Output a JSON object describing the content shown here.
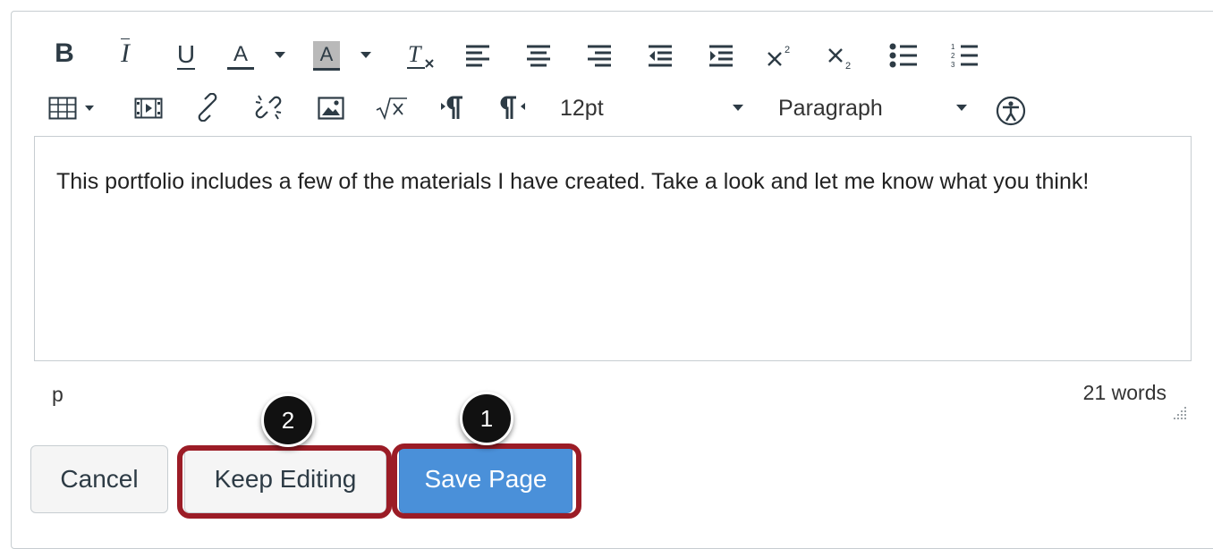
{
  "toolbar": {
    "row1": [
      {
        "icon": "bold-icon",
        "glyph": "B"
      },
      {
        "icon": "italic-icon",
        "glyph": "I"
      },
      {
        "icon": "underline-icon",
        "glyph": "U"
      },
      {
        "icon": "text-color-icon",
        "glyph": "A"
      },
      {
        "icon": "background-color-icon",
        "glyph": "A"
      },
      {
        "icon": "clear-formatting-icon",
        "glyph": "T"
      },
      {
        "icon": "align-left-icon"
      },
      {
        "icon": "align-center-icon"
      },
      {
        "icon": "align-right-icon"
      },
      {
        "icon": "outdent-icon"
      },
      {
        "icon": "indent-icon"
      },
      {
        "icon": "superscript-icon",
        "glyph": "x"
      },
      {
        "icon": "subscript-icon",
        "glyph": "x"
      },
      {
        "icon": "bullet-list-icon"
      },
      {
        "icon": "numbered-list-icon"
      }
    ],
    "font_size": "12pt",
    "block_format": "Paragraph"
  },
  "editor": {
    "content": "This portfolio includes a few of the materials I have created. Take a look and let me know what you think!"
  },
  "status": {
    "path": "p",
    "word_count": "21 words"
  },
  "buttons": {
    "cancel": "Cancel",
    "keep_editing": "Keep Editing",
    "save_page": "Save Page"
  },
  "callouts": {
    "save": "1",
    "keep": "2"
  },
  "colors": {
    "highlight": "#9b1c26",
    "primary": "#4a90d9"
  }
}
